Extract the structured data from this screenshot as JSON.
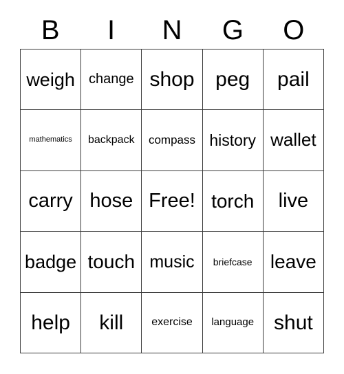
{
  "card": {
    "header_letters": [
      "B",
      "I",
      "N",
      "G",
      "O"
    ],
    "columns": 5,
    "rows": 5,
    "free_space_label": "Free!",
    "free_space_position": {
      "row": 3,
      "column": 3
    },
    "border_color": "#3a3a3a",
    "background_color": "#ffffff",
    "text_color": "#000000",
    "grid": [
      [
        {
          "text": "weigh",
          "size": 27
        },
        {
          "text": "change",
          "size": 20
        },
        {
          "text": "shop",
          "size": 30
        },
        {
          "text": "peg",
          "size": 30
        },
        {
          "text": "pail",
          "size": 30
        }
      ],
      [
        {
          "text": "mathematics",
          "size": 11
        },
        {
          "text": "backpack",
          "size": 16
        },
        {
          "text": "compass",
          "size": 17
        },
        {
          "text": "history",
          "size": 23
        },
        {
          "text": "wallet",
          "size": 26
        }
      ],
      [
        {
          "text": "carry",
          "size": 29
        },
        {
          "text": "hose",
          "size": 29
        },
        {
          "text": "Free!",
          "size": 29
        },
        {
          "text": "torch",
          "size": 28
        },
        {
          "text": "live",
          "size": 29
        }
      ],
      [
        {
          "text": "badge",
          "size": 27
        },
        {
          "text": "touch",
          "size": 28
        },
        {
          "text": "music",
          "size": 25
        },
        {
          "text": "briefcase",
          "size": 14
        },
        {
          "text": "leave",
          "size": 28
        }
      ],
      [
        {
          "text": "help",
          "size": 30
        },
        {
          "text": "kill",
          "size": 30
        },
        {
          "text": "exercise",
          "size": 16
        },
        {
          "text": "language",
          "size": 15
        },
        {
          "text": "shut",
          "size": 30
        }
      ]
    ]
  }
}
